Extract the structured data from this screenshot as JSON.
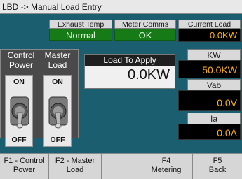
{
  "title": "LBD -> Manual Load Entry",
  "status": {
    "exhaust_temp": {
      "label": "Exhaust Temp",
      "value": "Normal"
    },
    "meter_comms": {
      "label": "Meter Comms",
      "value": "OK"
    },
    "current_load": {
      "label": "Current Load",
      "value": "0.0KW"
    }
  },
  "control_power": {
    "label_line1": "Control",
    "label_line2": "Power",
    "on": "ON",
    "off": "OFF"
  },
  "master_load": {
    "label_line1": "Master",
    "label_line2": "Load",
    "on": "ON",
    "off": "OFF"
  },
  "load_to_apply": {
    "label": "Load To Apply",
    "value": "0.0KW"
  },
  "meters": {
    "kw": {
      "label": "KW",
      "value": "50.0KW"
    },
    "vab": {
      "label": "Vab",
      "value": "0.0V"
    },
    "ia": {
      "label": "Ia",
      "value": "0.0A"
    }
  },
  "fkeys": [
    {
      "line1": "F1 - Control",
      "line2": "Power"
    },
    {
      "line1": "F2 - Master",
      "line2": "Load"
    },
    {
      "line1": "",
      "line2": ""
    },
    {
      "line1": "F4",
      "line2": "Metering"
    },
    {
      "line1": "F5",
      "line2": "Back"
    }
  ],
  "colors": {
    "background": "#1b5e70",
    "status_ok": "#167a16",
    "value_text": "#ffb400"
  }
}
